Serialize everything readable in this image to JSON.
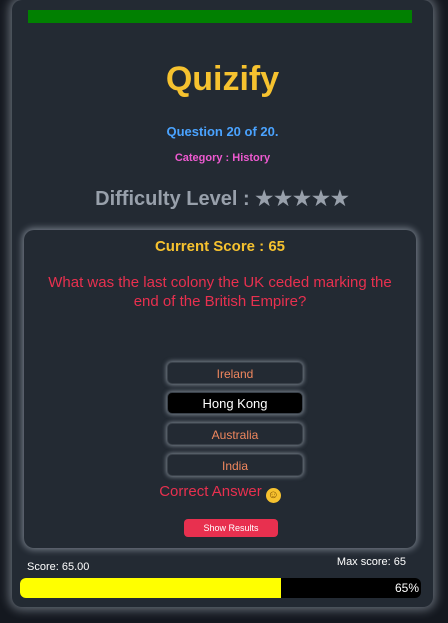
{
  "app": {
    "title": "Quizify"
  },
  "quiz": {
    "question_counter": "Question 20 of 20.",
    "category": "Category : History",
    "difficulty_label": "Difficulty Level :",
    "difficulty_stars": "★★★★★",
    "current_score": "Current Score : 65",
    "question": "What was the last colony the UK ceded marking the end of the British Empire?",
    "options": [
      "Ireland",
      "Hong Kong",
      "Australia",
      "India"
    ],
    "selected_option": "Hong Kong",
    "feedback": "Correct Answer",
    "feedback_emoji": "☺",
    "show_results_label": "Show Results"
  },
  "footer": {
    "score": "Score: 65.00",
    "max_score": "Max score: 65",
    "progress_percent": 65,
    "progress_text": "65%"
  },
  "colors": {
    "accent_title": "#f6c22f",
    "question_text": "#e8304f",
    "progress_fill": "#ffff00",
    "top_bar": "#018001"
  }
}
